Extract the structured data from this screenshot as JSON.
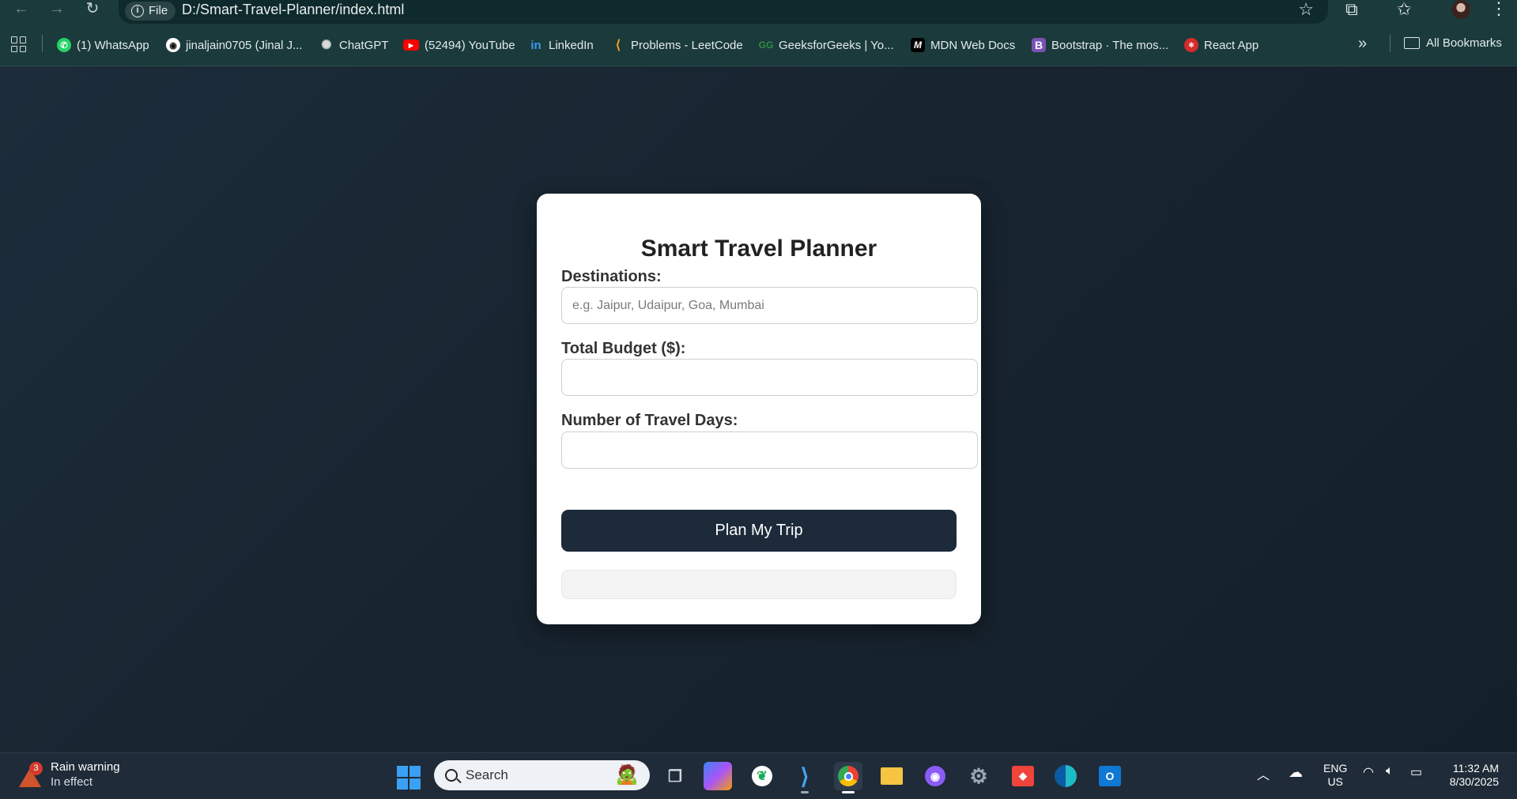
{
  "browser": {
    "site_chip": "File",
    "url": "D:/Smart-Travel-Planner/index.html",
    "bookmarks": [
      {
        "label": "(1) WhatsApp",
        "icon": "whatsapp-icon",
        "color": "#25d366"
      },
      {
        "label": "jinaljain0705 (Jinal J...",
        "icon": "github-icon",
        "color": "#ffffff"
      },
      {
        "label": "ChatGPT",
        "icon": "chatgpt-icon",
        "color": "#d9d9d9"
      },
      {
        "label": "(52494) YouTube",
        "icon": "youtube-icon",
        "color": "#ff0000"
      },
      {
        "label": "LinkedIn",
        "icon": "linkedin-icon",
        "color": "#0a66c2"
      },
      {
        "label": "Problems - LeetCode",
        "icon": "leetcode-icon",
        "color": "#f5a623"
      },
      {
        "label": "GeeksforGeeks | Yo...",
        "icon": "geeksforgeeks-icon",
        "color": "#2f8d46"
      },
      {
        "label": "MDN Web Docs",
        "icon": "mdn-icon",
        "color": "#000000"
      },
      {
        "label": "Bootstrap · The mos...",
        "icon": "bootstrap-icon",
        "color": "#7952b3"
      },
      {
        "label": "React App",
        "icon": "react-app-icon",
        "color": "#d62b2b"
      }
    ],
    "all_bookmarks": "All Bookmarks"
  },
  "planner": {
    "title": "Smart Travel Planner",
    "destinations_label": "Destinations:",
    "destinations_placeholder": "e.g. Jaipur, Udaipur, Goa, Mumbai",
    "destinations_value": "",
    "budget_label": "Total Budget ($):",
    "budget_value": "",
    "days_label": "Number of Travel Days:",
    "days_value": "",
    "button_label": "Plan My Trip",
    "result": ""
  },
  "taskbar": {
    "weather_badge": "3",
    "weather_title": "Rain warning",
    "weather_sub": "In effect",
    "search_label": "Search",
    "lang_top": "ENG",
    "lang_bottom": "US",
    "time": "11:32 AM",
    "date": "8/30/2025"
  }
}
